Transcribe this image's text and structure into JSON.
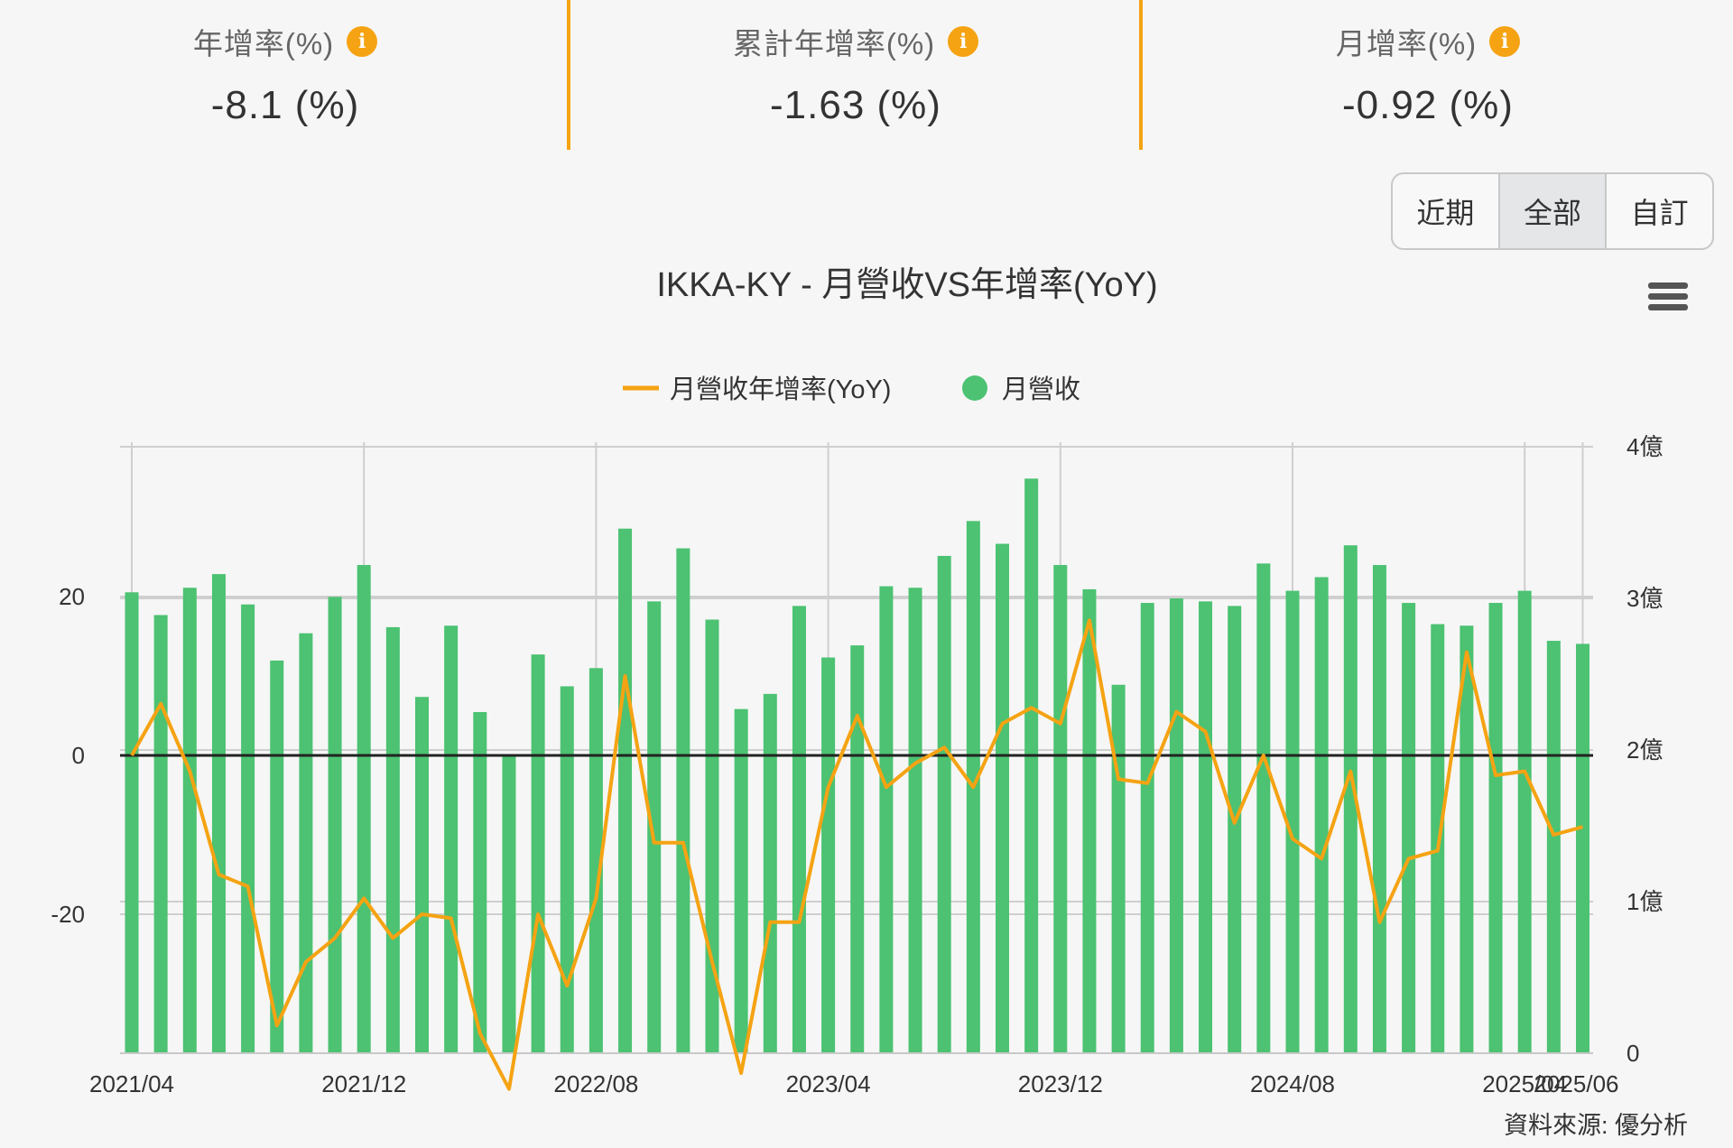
{
  "kpis": [
    {
      "label": "年增率(%)",
      "value": "-8.1 (%)"
    },
    {
      "label": "累計年增率(%)",
      "value": "-1.63 (%)"
    },
    {
      "label": "月增率(%)",
      "value": "-0.92 (%)"
    }
  ],
  "info_icon_glyph": "i",
  "range_buttons": [
    "近期",
    "全部",
    "自訂"
  ],
  "active_range": "全部",
  "colors": {
    "accent": "#f5a313",
    "bar": "#4cc272",
    "line": "#f5a313"
  },
  "source_text": "資料來源: 優分析",
  "chart_data": {
    "type": "bar+line",
    "title": "IKKA-KY - 月營收VS年增率(YoY)",
    "legend_position": "top-center",
    "grid": true,
    "x_tick_labels": [
      "2021/04",
      "2021/12",
      "2022/08",
      "2023/04",
      "2023/12",
      "2024/08",
      "2025/04",
      "2025/06"
    ],
    "left_axis": {
      "ticks": [
        "20",
        "0",
        "-20"
      ]
    },
    "right_axis": {
      "ticks": [
        "4億",
        "3億",
        "2億",
        "1億",
        "0"
      ]
    },
    "series": [
      {
        "name": "月營收年增率(YoY)",
        "type": "line",
        "axis": "left",
        "values": [
          0,
          6.5,
          -2,
          -15,
          -16.5,
          -34,
          -26,
          -23,
          -18,
          -23,
          -20,
          -20.5,
          -35,
          -42,
          -20,
          -29,
          -18,
          10,
          -11,
          -11,
          -26,
          -40,
          -21,
          -21,
          -4,
          5,
          -4,
          -1,
          1,
          -4,
          4,
          6,
          4,
          17,
          -3,
          -3.5,
          5.5,
          3,
          -8.5,
          0,
          -10.5,
          -13,
          -2,
          -21,
          -13,
          -12,
          13,
          -2.5,
          -2,
          -10,
          -9
        ]
      },
      {
        "name": "月營收",
        "type": "bar",
        "axis": "right",
        "unit": "億",
        "values": [
          3.04,
          2.89,
          3.07,
          3.16,
          2.96,
          2.59,
          2.77,
          3.01,
          3.22,
          2.81,
          2.35,
          2.82,
          2.25,
          1.96,
          2.63,
          2.42,
          2.54,
          3.46,
          2.98,
          3.33,
          2.86,
          2.27,
          2.37,
          2.95,
          2.61,
          2.69,
          3.08,
          3.07,
          3.28,
          3.51,
          3.36,
          3.79,
          3.22,
          3.06,
          2.43,
          2.97,
          3.0,
          2.98,
          2.95,
          3.23,
          3.05,
          3.14,
          3.35,
          3.22,
          2.97,
          2.83,
          2.82,
          2.97,
          3.05,
          2.72,
          2.7
        ]
      }
    ]
  }
}
